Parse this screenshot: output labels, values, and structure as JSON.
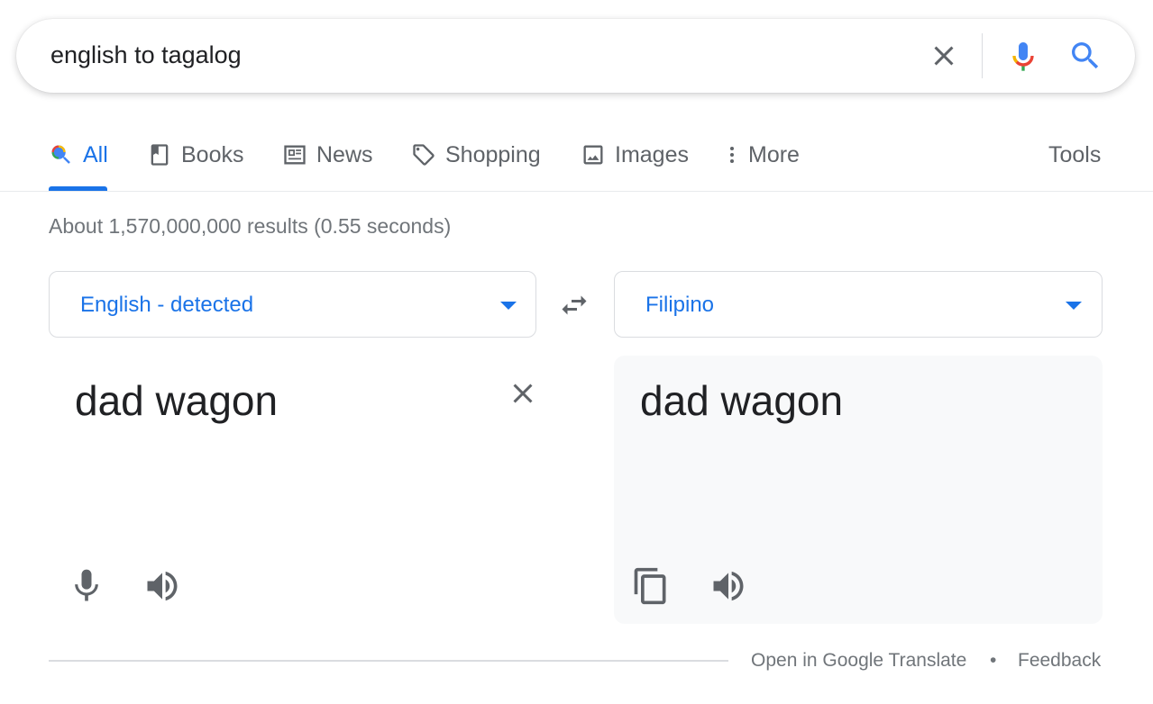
{
  "search": {
    "query": "english to tagalog",
    "icons": {
      "clear": "close-icon",
      "voice": "mic-icon",
      "submit": "search-icon"
    }
  },
  "tabs": [
    {
      "label": "All",
      "icon": "search-icon",
      "active": true
    },
    {
      "label": "Books",
      "icon": "book-icon",
      "active": false
    },
    {
      "label": "News",
      "icon": "news-icon",
      "active": false
    },
    {
      "label": "Shopping",
      "icon": "tag-icon",
      "active": false
    },
    {
      "label": "Images",
      "icon": "image-icon",
      "active": false
    },
    {
      "label": "More",
      "icon": "more-vert-icon",
      "active": false
    }
  ],
  "tools_label": "Tools",
  "result_stats": "About 1,570,000,000 results (0.55 seconds)",
  "translate": {
    "source_language": "English - detected",
    "target_language": "Filipino",
    "source_text": "dad wagon",
    "target_text": "dad wagon"
  },
  "footer": {
    "open_link": "Open in Google Translate",
    "separator": "•",
    "feedback": "Feedback"
  },
  "colors": {
    "accent": "#1a73e8",
    "text": "#202124",
    "muted": "#70757a",
    "icon_gray": "#5f6368",
    "panel_bg": "#f8f9fa",
    "border": "#dadce0"
  }
}
